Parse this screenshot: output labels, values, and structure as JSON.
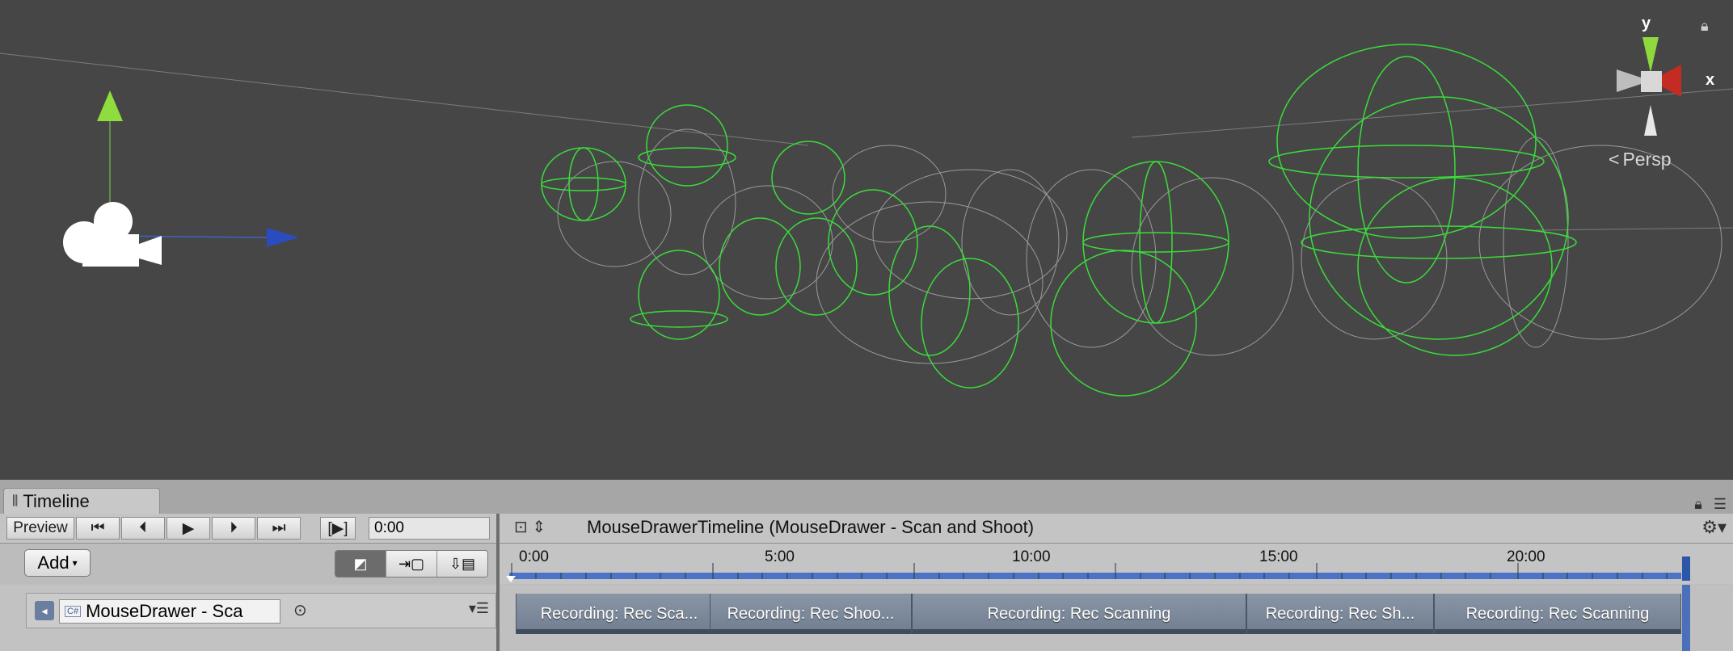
{
  "scene": {
    "view_label": "Persp",
    "axes": {
      "y": "y",
      "x": "x"
    },
    "gizmo_icon": "camera-icon",
    "lock_icon": "lock-icon"
  },
  "timeline": {
    "tab_title": "Timeline",
    "toolbar": {
      "preview_label": "Preview",
      "time_value": "0:00",
      "asset_name": "MouseDrawerTimeline (MouseDrawer - Scan and Shoot)"
    },
    "add_label": "Add",
    "ruler_labels": [
      "0:00",
      "5:00",
      "10:00",
      "15:00",
      "20:00"
    ],
    "track": {
      "object_name": "MouseDrawer - Sca",
      "script_badge": "C#"
    },
    "clips": [
      {
        "label": "Recording: Rec Sca..."
      },
      {
        "label": "Recording: Rec Shoo..."
      },
      {
        "label": "Recording: Rec Scanning"
      },
      {
        "label": "Recording: Rec Sh..."
      },
      {
        "label": "Recording: Rec Scanning"
      }
    ]
  },
  "colors": {
    "scene_bg": "#464646",
    "wire_green": "#3bdc3b",
    "wire_gray": "#9a9a9a",
    "clip_blue": "#7f8c9d",
    "timeline_blue": "#4b74c8"
  }
}
